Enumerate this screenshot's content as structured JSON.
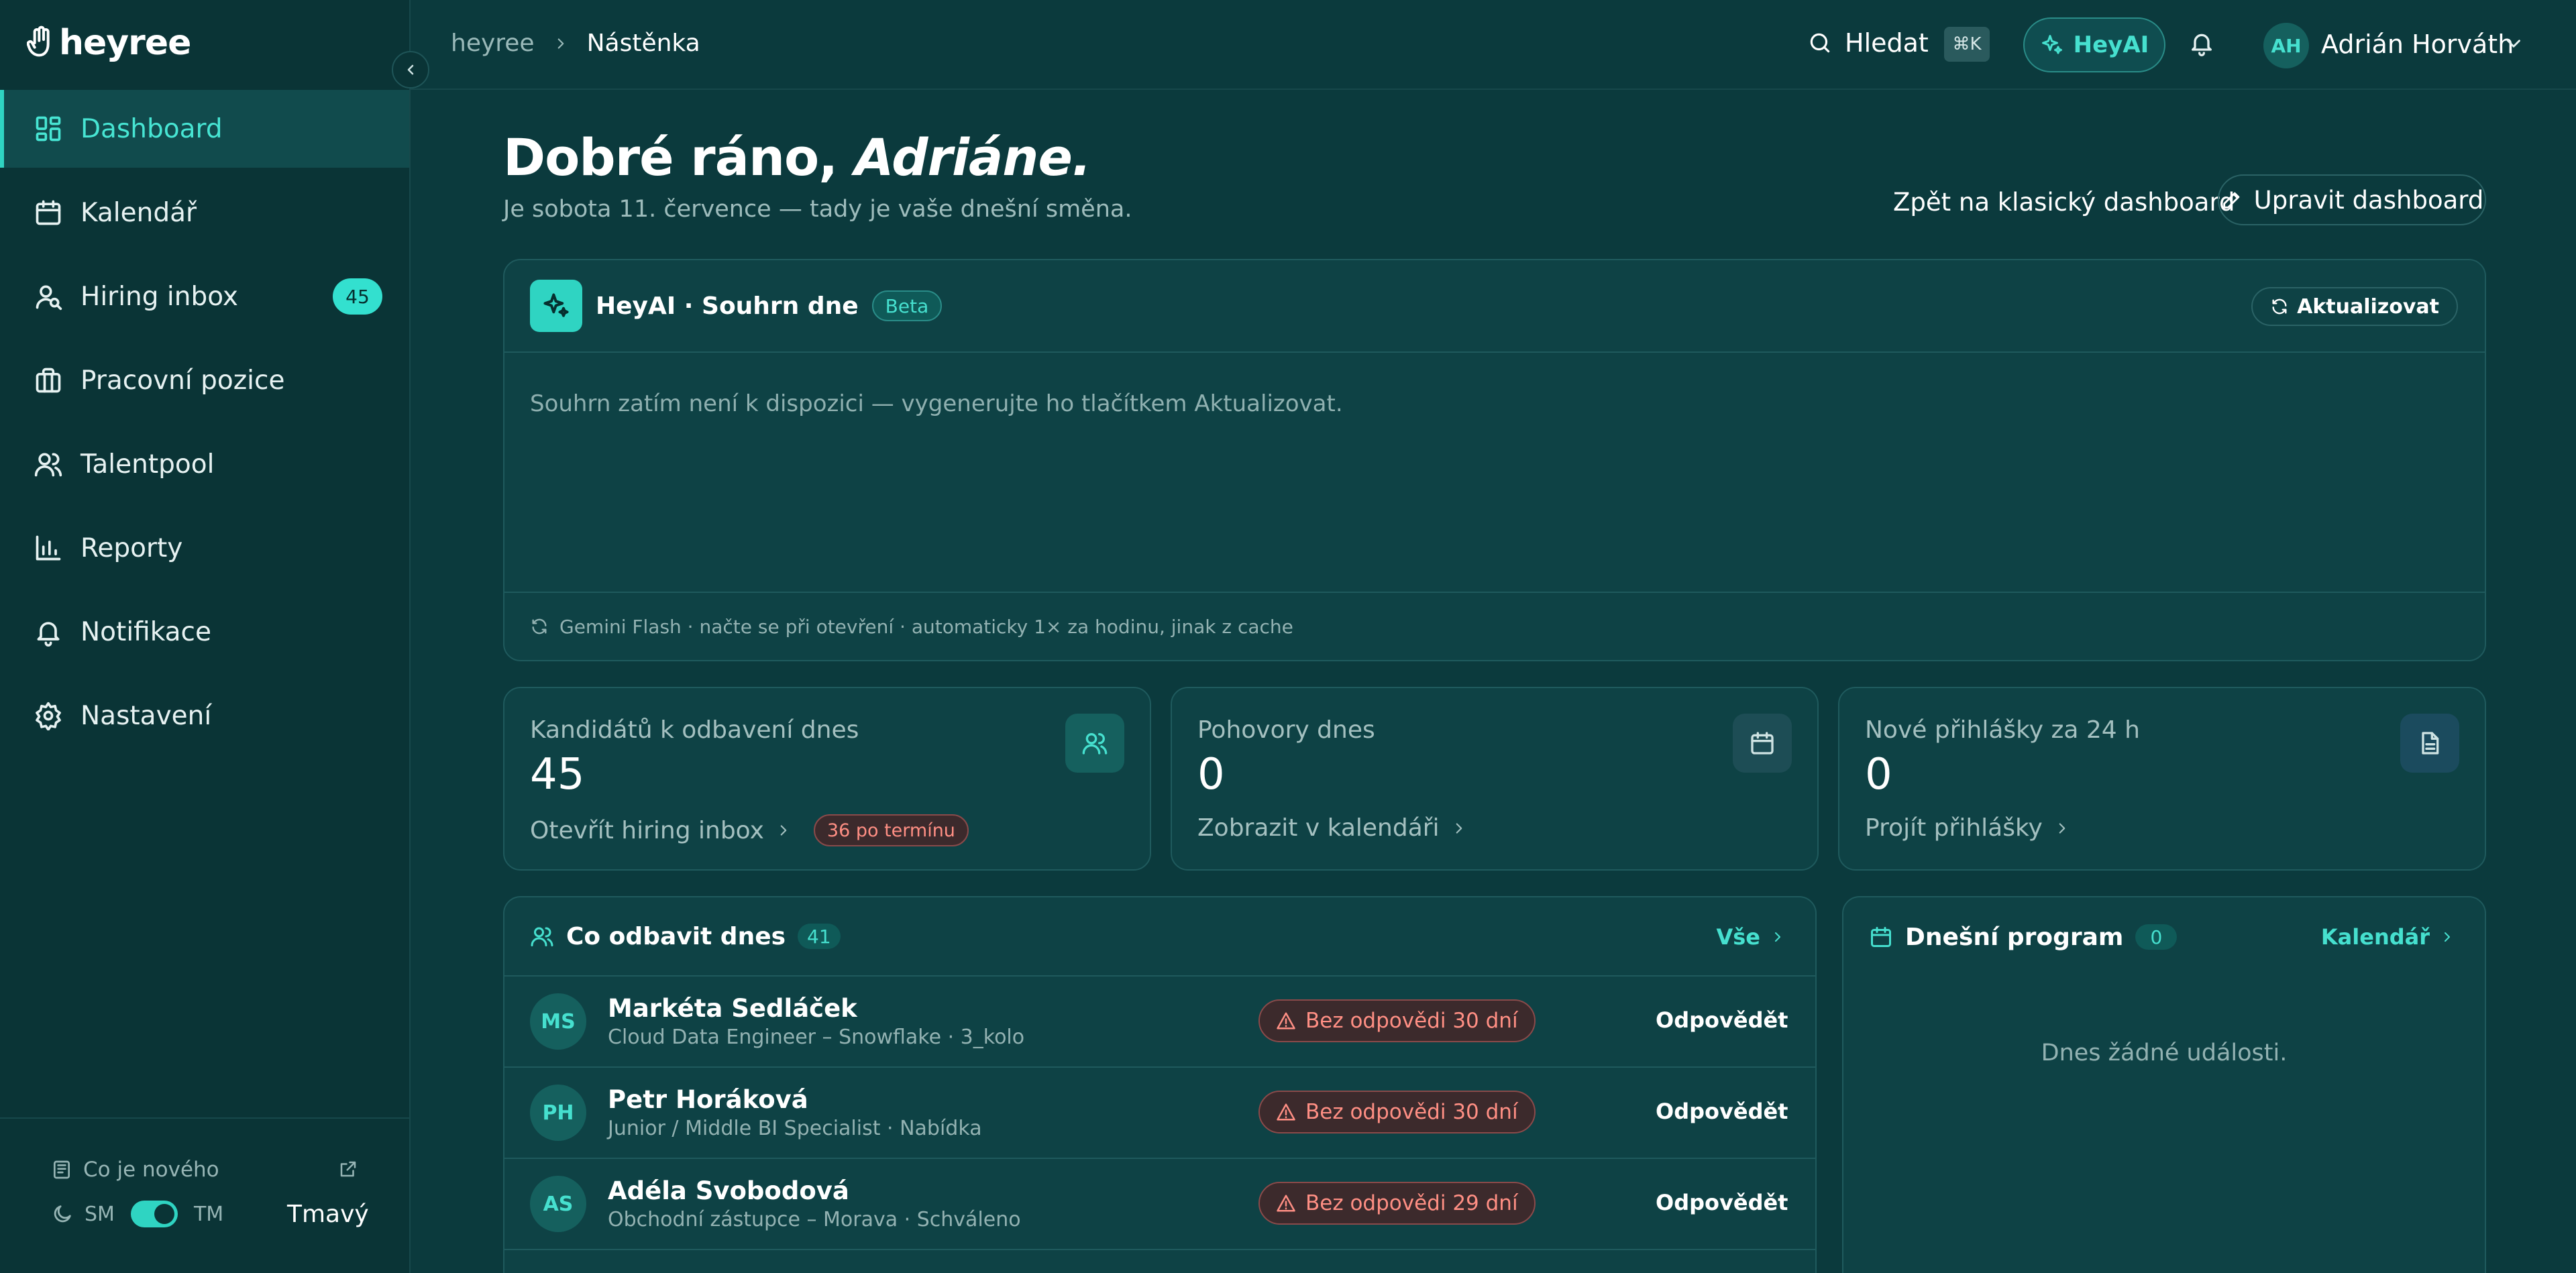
{
  "colors": {
    "accent": "#2fd4c2",
    "background": "#0b3a3d",
    "sidebar": "#0a3436",
    "card": "#0e4245",
    "warning": "#ff8f84"
  },
  "sidebar": {
    "logo": "heyree",
    "items": [
      {
        "label": "Dashboard",
        "icon": "grid-icon",
        "active": true
      },
      {
        "label": "Kalendář",
        "icon": "calendar-icon"
      },
      {
        "label": "Hiring inbox",
        "icon": "user-search-icon",
        "badge": "45"
      },
      {
        "label": "Pracovní pozice",
        "icon": "briefcase-icon"
      },
      {
        "label": "Talentpool",
        "icon": "users-icon"
      },
      {
        "label": "Reporty",
        "icon": "bar-chart-icon"
      },
      {
        "label": "Notifikace",
        "icon": "bell-icon"
      },
      {
        "label": "Nastavení",
        "icon": "gear-icon"
      }
    ],
    "whats_new": "Co je nového",
    "theme": {
      "left": "SM",
      "right": "TM",
      "value": "Tmavý"
    }
  },
  "topbar": {
    "breadcrumb": [
      "heyree",
      "Nástěnka"
    ],
    "search_label": "Hledat",
    "shortcut": "⌘K",
    "heyai_label": "HeyAI",
    "user_initials": "AH",
    "user_name": "Adrián Horváth"
  },
  "header": {
    "greeting": "Dobré ráno,",
    "greeting_name": "Adriáne.",
    "subtitle": "Je sobota 11. července — tady je vaše dnešní směna.",
    "classic_link": "Zpět na klasický dashboard",
    "edit_button": "Upravit dashboard"
  },
  "ai_summary": {
    "title": "HeyAI · Souhrn dne",
    "badge": "Beta",
    "refresh_label": "Aktualizovat",
    "body": "Souhrn zatím není k dispozici — vygenerujte ho tlačítkem Aktualizovat.",
    "footer": "Gemini Flash · načte se při otevření · automaticky 1× za hodinu, jinak z cache"
  },
  "stats": [
    {
      "label": "Kandidátů k odbavení dnes",
      "value": "45",
      "link": "Otevřít hiring inbox",
      "badge": "36 po termínu",
      "icon": "users-icon"
    },
    {
      "label": "Pohovory dnes",
      "value": "0",
      "link": "Zobrazit v kalendáři",
      "icon": "calendar-icon"
    },
    {
      "label": "Nové přihlášky za 24 h",
      "value": "0",
      "link": "Projít přihlášky",
      "icon": "document-icon"
    }
  ],
  "todo": {
    "title": "Co odbavit dnes",
    "count": "41",
    "link": "Vše",
    "rows": [
      {
        "initials": "MS",
        "name": "Markéta Sedláček",
        "sub": "Cloud Data Engineer – Snowflake · 3_kolo",
        "warning": "Bez odpovědi 30 dní",
        "action": "Odpovědět"
      },
      {
        "initials": "PH",
        "name": "Petr Horáková",
        "sub": "Junior / Middle BI Specialist · Nabídka",
        "warning": "Bez odpovědi 30 dní",
        "action": "Odpovědět"
      },
      {
        "initials": "AS",
        "name": "Adéla Svobodová",
        "sub": "Obchodní zástupce – Morava · Schváleno",
        "warning": "Bez odpovědi 29 dní",
        "action": "Odpovědět"
      }
    ]
  },
  "program": {
    "title": "Dnešní program",
    "count": "0",
    "link": "Kalendář",
    "empty": "Dnes žádné události."
  }
}
